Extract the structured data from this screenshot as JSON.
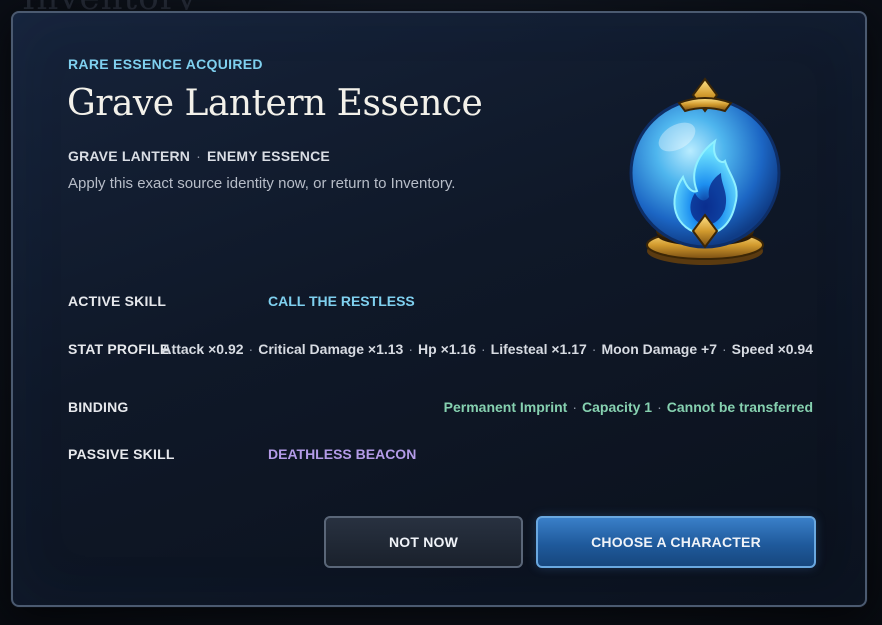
{
  "background": {
    "title": "Inventory"
  },
  "modal": {
    "eyebrow": "RARE ESSENCE ACQUIRED",
    "title": "Grave Lantern Essence",
    "source": "GRAVE LANTERN",
    "type": "ENEMY ESSENCE",
    "separator": "·",
    "hint": "Apply this exact source identity now, or return to Inventory.",
    "icon": "blue-flame-orb-icon"
  },
  "rows": {
    "active_skill": {
      "label": "ACTIVE SKILL",
      "value": "CALL THE RESTLESS"
    },
    "stat_profile": {
      "label": "STAT PROFILE",
      "stats": [
        "Attack ×0.92",
        "Critical Damage ×1.13",
        "Hp ×1.16",
        "Lifesteal ×1.17",
        "Moon Damage +7",
        "Speed ×0.94"
      ]
    },
    "binding": {
      "label": "BINDING",
      "items": [
        "Permanent Imprint",
        "Capacity 1",
        "Cannot be transferred"
      ]
    },
    "passive_skill": {
      "label": "PASSIVE SKILL",
      "value": "DEATHLESS BEACON"
    }
  },
  "buttons": {
    "secondary": "NOT NOW",
    "primary": "CHOOSE A CHARACTER"
  },
  "colors": {
    "accent_cyan": "#7fd0ef",
    "accent_purple": "#b49be8",
    "accent_green": "#86d1b0",
    "primary_button": "#2a6bb4"
  }
}
